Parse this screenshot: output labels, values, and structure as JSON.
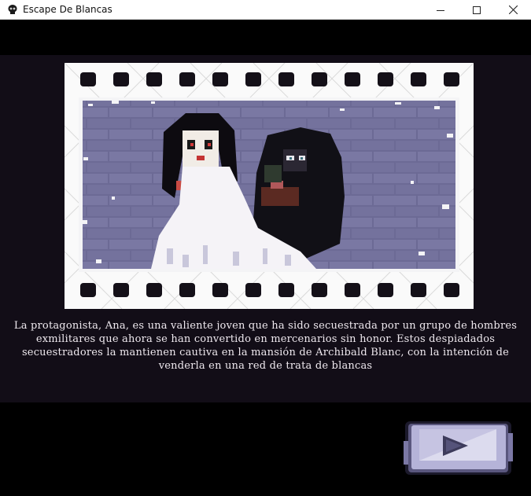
{
  "window": {
    "title": "Escape De Blancas",
    "app_icon": "skull-app-icon",
    "controls": [
      "minimize-icon",
      "maximize-icon",
      "close-icon"
    ]
  },
  "scene": {
    "illustration": "pixel-art-kidnapping-scene",
    "frame_style": "film-strip"
  },
  "story": {
    "text": "La protagonista, Ana, es una valiente joven que ha sido secuestrada por un grupo de hombres exmilitares que ahora se han convertido en mercenarios sin honor. Estos despiadados secuestradores la mantienen cautiva en la mansión de Archibald Blanc, con la intención de venderla en una red de trata de blancas"
  },
  "controls": {
    "next_icon": "play-arrow-icon"
  },
  "colors": {
    "background": "#000000",
    "panel": "#120d17",
    "text": "#efe9ef",
    "brick": "#6d6b96",
    "button": "#b3b0d6"
  }
}
